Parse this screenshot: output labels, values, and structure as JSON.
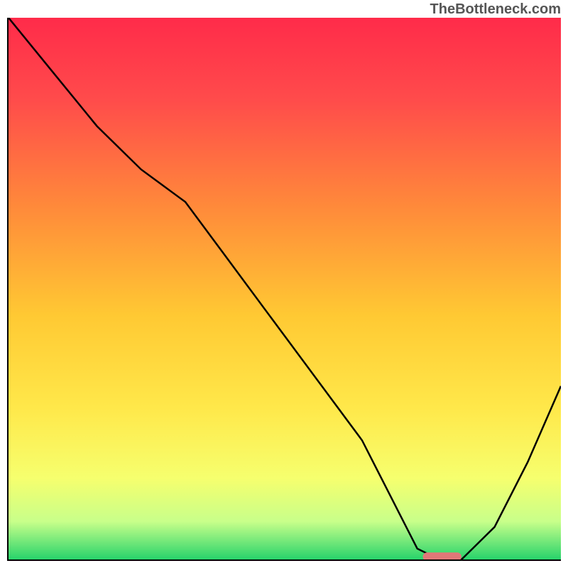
{
  "watermark": "TheBottleneck.com",
  "chart_data": {
    "type": "line",
    "title": "",
    "xlabel": "",
    "ylabel": "",
    "xlim": [
      0,
      100
    ],
    "ylim": [
      0,
      100
    ],
    "grid": false,
    "legend": false,
    "series": [
      {
        "name": "bottleneck-curve",
        "x": [
          0,
          8,
          16,
          24,
          32,
          40,
          48,
          56,
          64,
          70,
          74,
          78,
          82,
          88,
          94,
          100
        ],
        "y": [
          100,
          90,
          80,
          72,
          66,
          55,
          44,
          33,
          22,
          10,
          2,
          0,
          0,
          6,
          18,
          32
        ],
        "color": "#000000"
      }
    ],
    "marker": {
      "name": "optimal-segment",
      "x_start": 75,
      "x_end": 82,
      "y": 0.5,
      "color": "#e07878"
    },
    "background_gradient": {
      "stops": [
        {
          "offset": 0.0,
          "color": "#ff2b4a"
        },
        {
          "offset": 0.15,
          "color": "#ff4b4b"
        },
        {
          "offset": 0.35,
          "color": "#ff8a3a"
        },
        {
          "offset": 0.55,
          "color": "#ffc933"
        },
        {
          "offset": 0.72,
          "color": "#ffe84a"
        },
        {
          "offset": 0.85,
          "color": "#f6ff6e"
        },
        {
          "offset": 0.93,
          "color": "#c8ff8a"
        },
        {
          "offset": 1.0,
          "color": "#27d36b"
        }
      ]
    }
  }
}
